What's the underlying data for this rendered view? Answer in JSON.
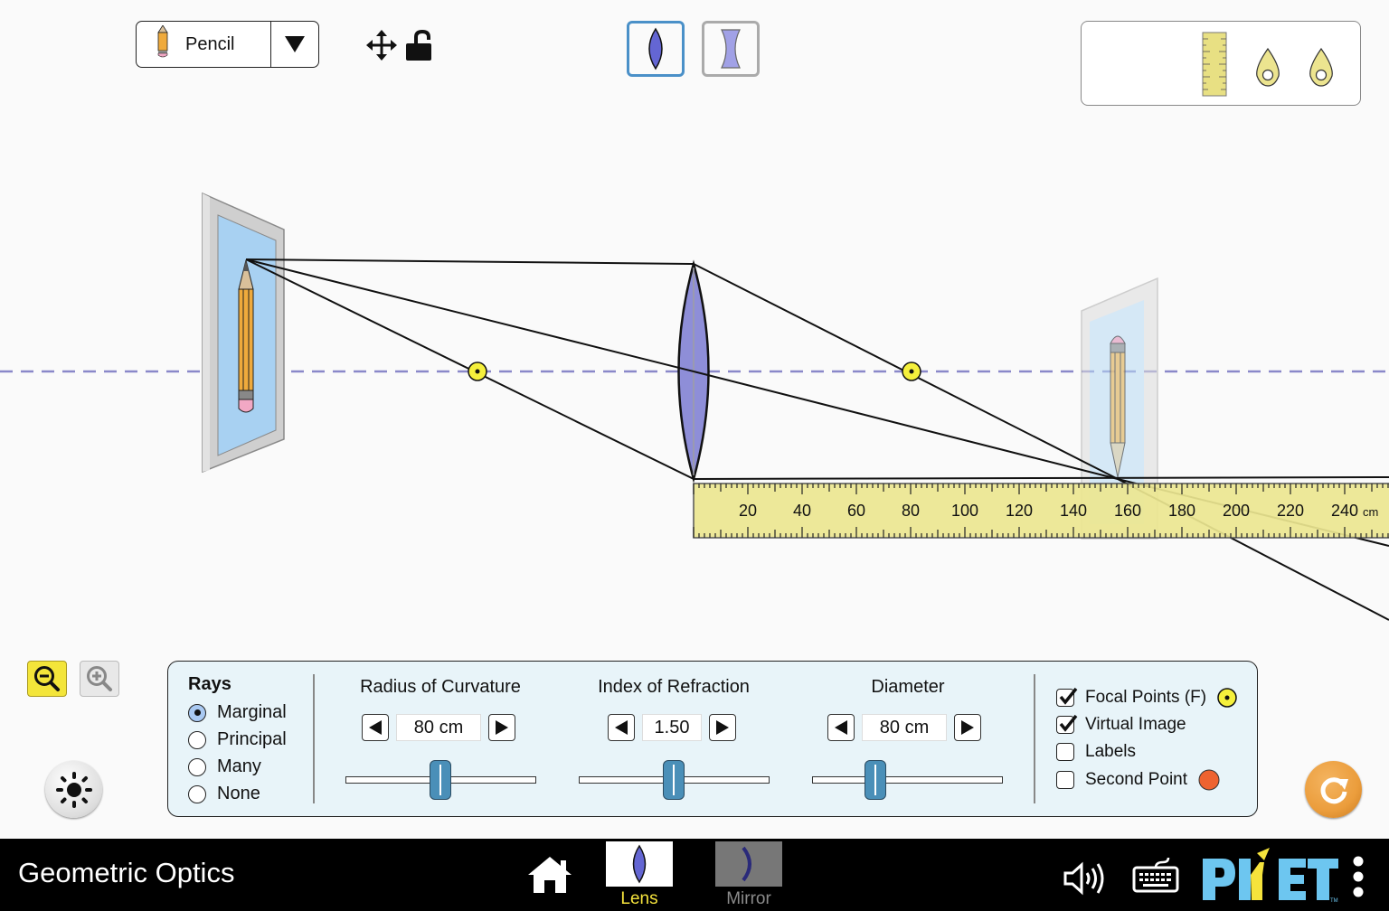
{
  "app": {
    "title": "Geometric Optics",
    "brand": "PhET"
  },
  "object_selector": {
    "selected": "Pencil",
    "icon": "pencil-icon",
    "dropdown_icon": "triangle-down-icon"
  },
  "top_tools": {
    "move_icon": "four-way-arrow-icon",
    "lock_icon": "unlocked-padlock-icon"
  },
  "lens_type": {
    "options": [
      {
        "name": "convex-lens",
        "selected": true
      },
      {
        "name": "concave-lens",
        "selected": false
      }
    ]
  },
  "toolbox": {
    "items": [
      "ruler",
      "focal-point-marker",
      "focal-point-marker"
    ]
  },
  "scene": {
    "optical_axis_color": "#8a88c9",
    "lens_color": "#8e8ed8",
    "focal_point_color": "#f5f03c",
    "object_label": "Pencil",
    "image_type": "real, inverted"
  },
  "ruler": {
    "unit": "cm",
    "ticks": [
      "20",
      "40",
      "60",
      "80",
      "100",
      "120",
      "140",
      "160",
      "180",
      "200",
      "220",
      "240"
    ]
  },
  "zoom": {
    "zoom_out_active": true,
    "zoom_in_active": false
  },
  "panel": {
    "rays": {
      "title": "Rays",
      "options": [
        {
          "label": "Marginal",
          "selected": true
        },
        {
          "label": "Principal",
          "selected": false
        },
        {
          "label": "Many",
          "selected": false
        },
        {
          "label": "None",
          "selected": false
        }
      ]
    },
    "radius": {
      "label": "Radius of Curvature",
      "value": "80 cm",
      "slider_fraction": 0.5
    },
    "index": {
      "label": "Index of Refraction",
      "value": "1.50",
      "slider_fraction": 0.5
    },
    "diameter": {
      "label": "Diameter",
      "value": "80 cm",
      "slider_fraction": 0.33
    },
    "checks": [
      {
        "label": "Focal Points (F)",
        "checked": true,
        "marker_color": "#f5f03c"
      },
      {
        "label": "Virtual Image",
        "checked": true
      },
      {
        "label": "Labels",
        "checked": false
      },
      {
        "label": "Second Point",
        "checked": false,
        "marker_color": "#ee6330"
      }
    ]
  },
  "reset_button": {
    "color": "#eb9d3c"
  },
  "nav": {
    "screens": [
      {
        "label": "Lens",
        "selected": true,
        "label_color": "#f5e33c"
      },
      {
        "label": "Mirror",
        "selected": false,
        "label_color": "#8a8a8a"
      }
    ],
    "home_icon": "home-icon",
    "sound_icon": "speaker-icon",
    "keyboard_icon": "keyboard-icon",
    "menu_icon": "kebab-menu-icon"
  }
}
